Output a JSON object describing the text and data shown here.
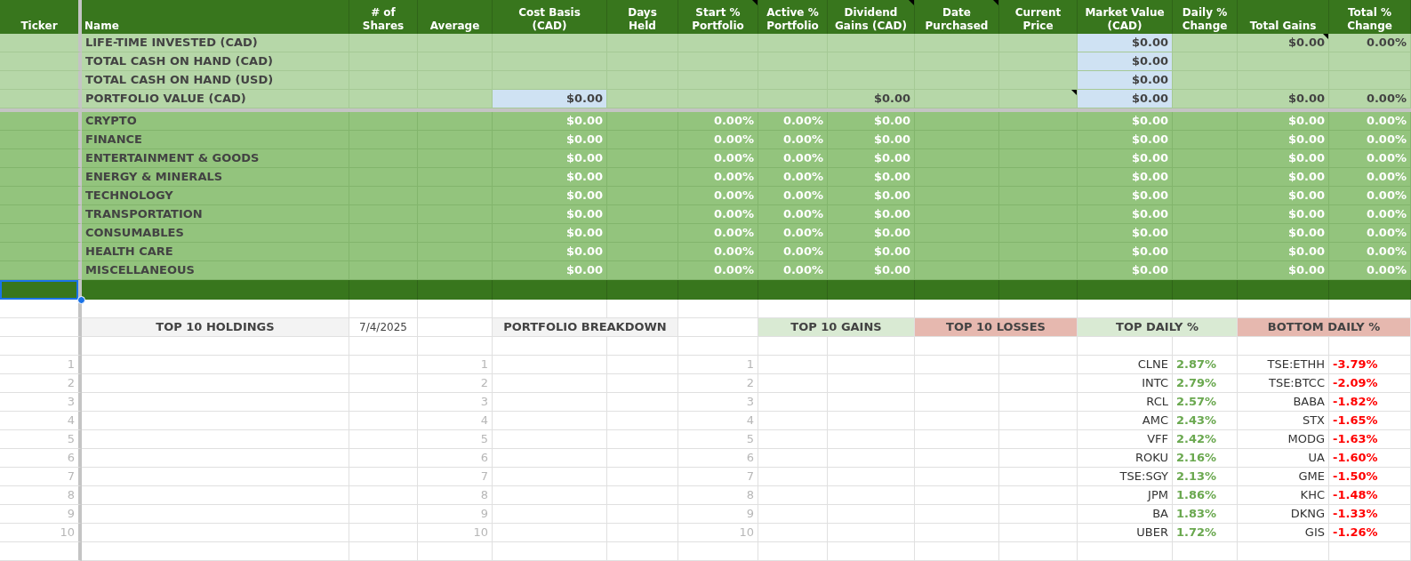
{
  "columns": [
    {
      "label": "Ticker",
      "note": false
    },
    {
      "label": "Name",
      "note": false
    },
    {
      "label": "# of\nShares",
      "note": false
    },
    {
      "label": "Average",
      "note": false
    },
    {
      "label": "Cost Basis\n(CAD)",
      "note": false
    },
    {
      "label": "Days\nHeld",
      "note": false
    },
    {
      "label": "Start %\nPortfolio",
      "note": true
    },
    {
      "label": "Active %\nPortfolio",
      "note": false
    },
    {
      "label": "Dividend\nGains (CAD)",
      "note": true
    },
    {
      "label": "Date\nPurchased",
      "note": true
    },
    {
      "label": "Current\nPrice",
      "note": false
    },
    {
      "label": "Market Value\n(CAD)",
      "note": false
    },
    {
      "label": "Daily %\nChange",
      "note": false
    },
    {
      "label": "Total Gains",
      "note": false
    },
    {
      "label": "Total %\nChange",
      "note": false
    }
  ],
  "summary_rows": [
    {
      "label": "LIFE-TIME INVESTED (CAD)",
      "market_value": {
        "text": "$0.00",
        "highlighted": true
      },
      "total_gains": {
        "text": "$0.00",
        "note": true
      },
      "total_pct": {
        "text": "0.00%"
      }
    },
    {
      "label": "TOTAL CASH ON HAND (CAD)",
      "market_value": {
        "text": "$0.00",
        "highlighted": true
      }
    },
    {
      "label": "TOTAL CASH ON HAND (USD)",
      "market_value": {
        "text": "$0.00",
        "highlighted": true
      }
    },
    {
      "label": "PORTFOLIO VALUE (CAD)",
      "cost_basis": {
        "text": "$0.00",
        "highlighted": true
      },
      "dividend": {
        "text": "$0.00"
      },
      "current_price": {
        "note": true
      },
      "market_value": {
        "text": "$0.00",
        "highlighted": true
      },
      "total_gains": {
        "text": "$0.00"
      },
      "total_pct": {
        "text": "0.00%"
      }
    }
  ],
  "category_rows": [
    {
      "label": "CRYPTO",
      "values": [
        "$0.00",
        "0.00%",
        "0.00%",
        "$0.00",
        "$0.00",
        "$0.00",
        "0.00%"
      ]
    },
    {
      "label": "FINANCE",
      "values": [
        "$0.00",
        "0.00%",
        "0.00%",
        "$0.00",
        "$0.00",
        "$0.00",
        "0.00%"
      ]
    },
    {
      "label": "ENTERTAINMENT & GOODS",
      "values": [
        "$0.00",
        "0.00%",
        "0.00%",
        "$0.00",
        "$0.00",
        "$0.00",
        "0.00%"
      ]
    },
    {
      "label": "ENERGY & MINERALS",
      "values": [
        "$0.00",
        "0.00%",
        "0.00%",
        "$0.00",
        "$0.00",
        "$0.00",
        "0.00%"
      ]
    },
    {
      "label": "TECHNOLOGY",
      "values": [
        "$0.00",
        "0.00%",
        "0.00%",
        "$0.00",
        "$0.00",
        "$0.00",
        "0.00%"
      ]
    },
    {
      "label": "TRANSPORTATION",
      "values": [
        "$0.00",
        "0.00%",
        "0.00%",
        "$0.00",
        "$0.00",
        "$0.00",
        "0.00%"
      ]
    },
    {
      "label": "CONSUMABLES",
      "values": [
        "$0.00",
        "0.00%",
        "0.00%",
        "$0.00",
        "$0.00",
        "$0.00",
        "0.00%"
      ]
    },
    {
      "label": "HEALTH CARE",
      "values": [
        "$0.00",
        "0.00%",
        "0.00%",
        "$0.00",
        "$0.00",
        "$0.00",
        "0.00%"
      ]
    },
    {
      "label": "MISCELLANEOUS",
      "values": [
        "$0.00",
        "0.00%",
        "0.00%",
        "$0.00",
        "$0.00",
        "$0.00",
        "0.00%"
      ]
    }
  ],
  "selection": {
    "visible": true
  },
  "section_headers": [
    {
      "kind": "title",
      "text": "TOP 10 HOLDINGS"
    },
    {
      "kind": "date",
      "text": "7/4/2025"
    },
    {
      "kind": "title",
      "text": "PORTFOLIO BREAKDOWN"
    },
    {
      "kind": "gain",
      "text": "TOP 10 GAINS"
    },
    {
      "kind": "loss",
      "text": "TOP 10 LOSSES"
    },
    {
      "kind": "gain",
      "text": "TOP DAILY %"
    },
    {
      "kind": "loss",
      "text": "BOTTOM DAILY %"
    }
  ],
  "ranked_rows": [
    {
      "ranks": [
        "1",
        "1",
        "1"
      ],
      "top_ticker": "CLNE",
      "top_pct": "2.87%",
      "bottom_ticker": "TSE:ETHH",
      "bottom_pct": "-3.79%"
    },
    {
      "ranks": [
        "2",
        "2",
        "2"
      ],
      "top_ticker": "INTC",
      "top_pct": "2.79%",
      "bottom_ticker": "TSE:BTCC",
      "bottom_pct": "-2.09%"
    },
    {
      "ranks": [
        "3",
        "3",
        "3"
      ],
      "top_ticker": "RCL",
      "top_pct": "2.57%",
      "bottom_ticker": "BABA",
      "bottom_pct": "-1.82%"
    },
    {
      "ranks": [
        "4",
        "4",
        "4"
      ],
      "top_ticker": "AMC",
      "top_pct": "2.43%",
      "bottom_ticker": "STX",
      "bottom_pct": "-1.65%"
    },
    {
      "ranks": [
        "5",
        "5",
        "5"
      ],
      "top_ticker": "VFF",
      "top_pct": "2.42%",
      "bottom_ticker": "MODG",
      "bottom_pct": "-1.63%"
    },
    {
      "ranks": [
        "6",
        "6",
        "6"
      ],
      "top_ticker": "ROKU",
      "top_pct": "2.16%",
      "bottom_ticker": "UA",
      "bottom_pct": "-1.60%"
    },
    {
      "ranks": [
        "7",
        "7",
        "7"
      ],
      "top_ticker": "TSE:SGY",
      "top_pct": "2.13%",
      "bottom_ticker": "GME",
      "bottom_pct": "-1.50%"
    },
    {
      "ranks": [
        "8",
        "8",
        "8"
      ],
      "top_ticker": "JPM",
      "top_pct": "1.86%",
      "bottom_ticker": "KHC",
      "bottom_pct": "-1.48%"
    },
    {
      "ranks": [
        "9",
        "9",
        "9"
      ],
      "top_ticker": "BA",
      "top_pct": "1.83%",
      "bottom_ticker": "DKNG",
      "bottom_pct": "-1.33%"
    },
    {
      "ranks": [
        "10",
        "10",
        "10"
      ],
      "top_ticker": "UBER",
      "top_pct": "1.72%",
      "bottom_ticker": "GIS",
      "bottom_pct": "-1.26%"
    }
  ]
}
